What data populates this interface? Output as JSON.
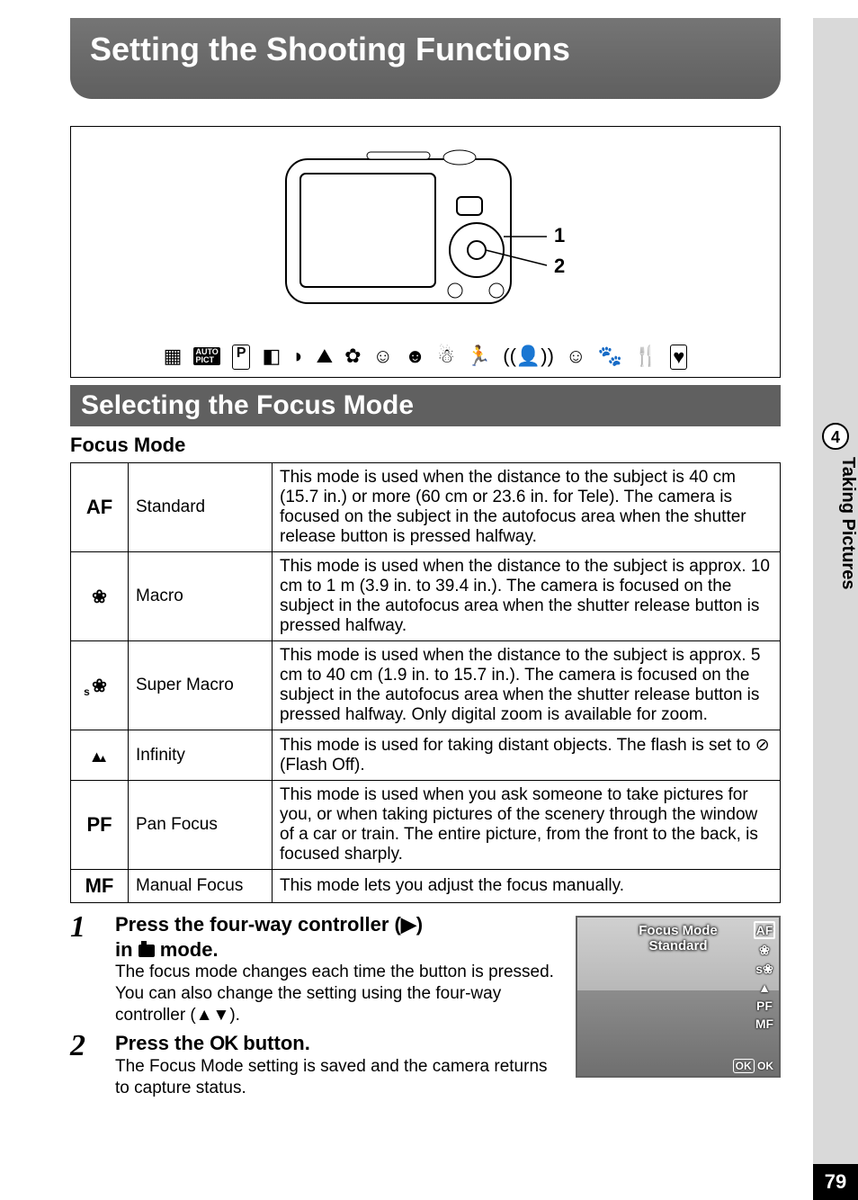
{
  "title": "Setting the Shooting Functions",
  "tab": {
    "number": "4",
    "label": "Taking Pictures"
  },
  "page_number": "79",
  "diagram": {
    "callouts": [
      "1",
      "2"
    ]
  },
  "mode_icons_alt": "Auto Pict, P, Night Scene, Night Scene Portrait, Landscape, Flower, Portrait, Natural Skin Tone, Surf & Snow, Sport, Digital SR, Kids, Pet, Food, Frame Composite",
  "section_title": "Selecting the Focus Mode",
  "table_heading": "Focus Mode",
  "table": [
    {
      "sym": "AF",
      "name": "Standard",
      "desc": "This mode is used when the distance to the subject is 40 cm (15.7 in.) or more (60 cm or 23.6 in. for Tele). The camera is focused on the subject in the autofocus area when the shutter release button is pressed halfway."
    },
    {
      "sym": "flower",
      "name": "Macro",
      "desc": "This mode is used when the distance to the subject is approx. 10 cm to 1 m (3.9 in. to 39.4 in.). The camera is focused on the subject in the autofocus area when the shutter release button is pressed halfway."
    },
    {
      "sym": "sflower",
      "name": "Super Macro",
      "desc": "This mode is used when the distance to the subject is approx. 5 cm to 40 cm (1.9 in. to 15.7 in.). The camera is focused on the subject in the autofocus area when the shutter release button is pressed halfway. Only digital zoom is available for zoom."
    },
    {
      "sym": "mountain",
      "name": "Infinity",
      "desc": "This mode is used for taking distant objects. The flash is set to ⊘ (Flash Off)."
    },
    {
      "sym": "PF",
      "name": "Pan Focus",
      "desc": "This mode is used when you ask someone to take pictures for you, or when taking pictures of the scenery through the window of a car or train. The entire picture, from the front to the back, is focused sharply."
    },
    {
      "sym": "MF",
      "name": "Manual Focus",
      "desc": "This mode lets you adjust the focus manually."
    }
  ],
  "steps": [
    {
      "num": "1",
      "title_a": "Press the four-way controller (▶)",
      "title_b": "in ",
      "title_c": " mode.",
      "desc": "The focus mode changes each time the button is pressed. You can also change the setting using the four-way controller (▲▼)."
    },
    {
      "num": "2",
      "title_a": "Press the ",
      "title_b": " button.",
      "ok": "OK",
      "desc": "The Focus Mode setting is saved and the camera returns to capture status."
    }
  ],
  "preview": {
    "line1": "Focus Mode",
    "line2": "Standard",
    "side": [
      "AF",
      "❀",
      "s❀",
      "▲",
      "PF",
      "MF"
    ],
    "ok_badge": "OK",
    "ok_text": "OK"
  }
}
